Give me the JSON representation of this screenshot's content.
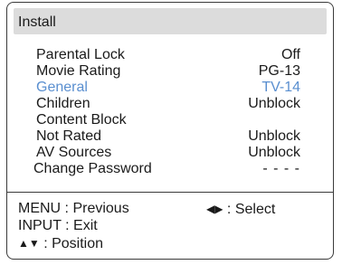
{
  "header": {
    "title": "Install"
  },
  "menu_items": [
    {
      "label": "Parental Lock",
      "value": "Off"
    },
    {
      "label": "Movie Rating",
      "value": "PG-13"
    },
    {
      "label": "General",
      "value": "TV-14"
    },
    {
      "label": "Children",
      "value": "Unblock"
    },
    {
      "label": "Content Block",
      "value": ""
    },
    {
      "label": "Not Rated",
      "value": "Unblock"
    },
    {
      "label": "AV Sources",
      "value": "Unblock"
    },
    {
      "label": "Change Password",
      "value": "- - - -"
    }
  ],
  "help": {
    "menu": "MENU : Previous",
    "select_arrows": "◀▶",
    "select": ": Select",
    "input": "INPUT : Exit",
    "position_arrows": "▲▼",
    "position": ": Position"
  },
  "colors": {
    "highlight": "#5a8fd0",
    "titlebar": "#dcdcdc",
    "border": "#3a3a3a"
  }
}
